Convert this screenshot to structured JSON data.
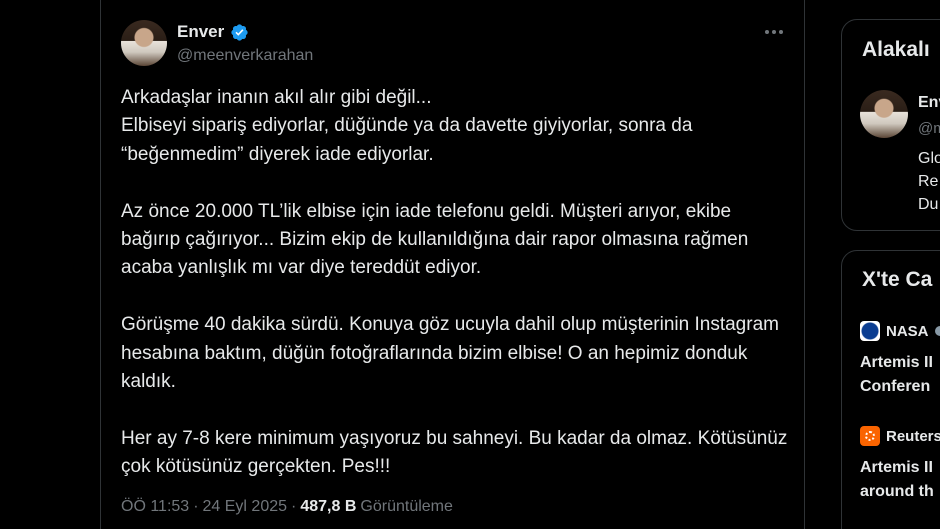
{
  "tweet": {
    "author": {
      "display_name": "Enver",
      "handle": "@meenverkarahan",
      "verified": true
    },
    "paragraphs": [
      "Arkadaşlar inanın akıl alır gibi değil...\nElbiseyi sipariş ediyorlar, düğünde ya da davette giyiyorlar, sonra da “beğenmedim” diyerek iade ediyorlar.",
      "Az önce 20.000 TL’lik elbise için iade telefonu geldi. Müşteri arıyor, ekibe bağırıp çağırıyor... Bizim ekip de kullanıldığına dair rapor olmasına rağmen acaba yanlışlık mı var diye tereddüt ediyor.",
      "Görüşme 40 dakika sürdü. Konuya göz ucuyla dahil olup müşterinin Instagram hesabına baktım, düğün fotoğraflarında bizim elbise! O an hepimiz donduk kaldık.",
      "Her ay 7-8 kere minimum yaşıyoruz bu sahneyi. Bu kadar da olmaz. Kötüsünüz çok kötüsünüz gerçekten. Pes!!!"
    ],
    "meta": {
      "time": "ÖÖ 11:53",
      "separator": "·",
      "date": "24 Eyl 2025",
      "views_count": "487,8 B",
      "views_label": "Görüntüleme"
    }
  },
  "sidebar": {
    "related": {
      "title": "Alakalı",
      "account": {
        "name": "Env",
        "handle": "@m",
        "bio_lines": [
          "Glo",
          "Re",
          "Du"
        ]
      }
    },
    "trends": {
      "title": "X'te Ca",
      "items": [
        {
          "source": "NASA",
          "source_icon": "nasa-logo-icon",
          "headline_lines": [
            "Artemis II",
            "Conferen"
          ]
        },
        {
          "source": "Reuters",
          "source_icon": "reuters-logo-icon",
          "headline_lines": [
            "Artemis II",
            "around th"
          ]
        }
      ]
    }
  },
  "colors": {
    "background": "#000000",
    "text": "#e7e9ea",
    "muted": "#71767b",
    "border": "#2f3336",
    "verified": "#1d9bf0"
  }
}
